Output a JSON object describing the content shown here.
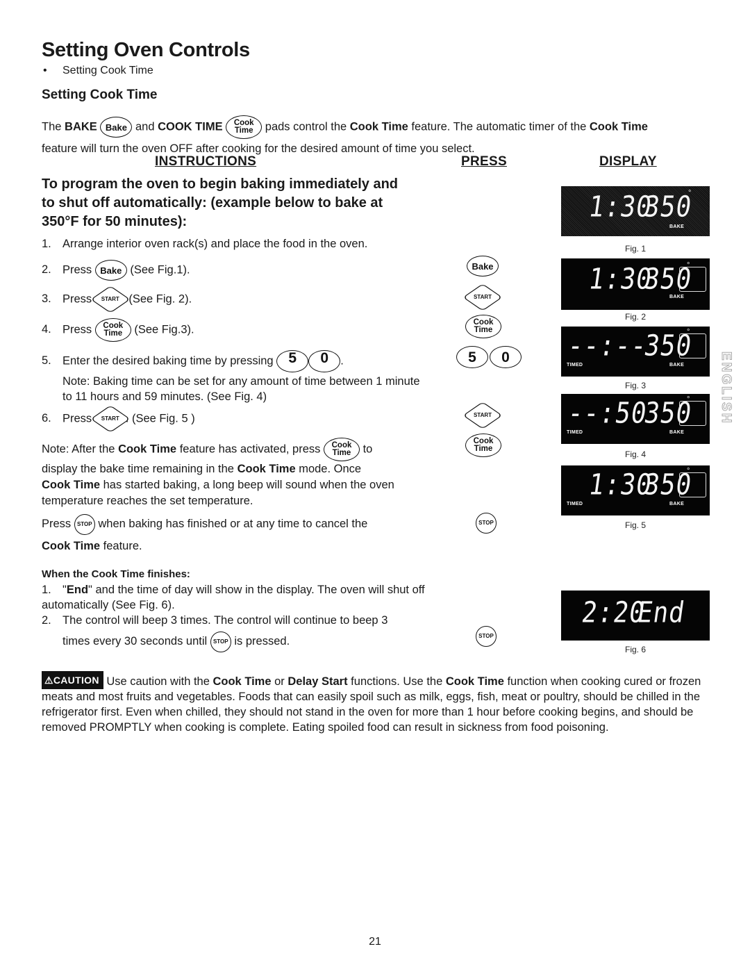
{
  "page": {
    "title": "Setting Oven Controls",
    "bullet": "Setting Cook Time",
    "section_heading": "Setting Cook Time",
    "page_number": "21",
    "side_tab": "ENGLISH"
  },
  "intro": {
    "p1": "The ",
    "bake_bold": "BAKE",
    "and": " and ",
    "cook_time_bold": "COOK TIME",
    "p2": " pads control the ",
    "ct1": "Cook Time",
    "p3": " feature. The automatic timer of the ",
    "ct2": "Cook Time",
    "p4": "feature will turn the oven OFF after cooking for the desired amount of time you select."
  },
  "columns": {
    "instructions": "INSTRUCTIONS",
    "press": "PRESS",
    "display": "DISPLAY"
  },
  "program_title": "To program the oven to begin baking immediately and to shut off automatically: (example below to bake at 350°F for 50 minutes):",
  "pads": {
    "bake": "Bake",
    "start": "START",
    "cook_line1": "Cook",
    "cook_line2": "Time",
    "stop": "STOP",
    "five": "5",
    "zero": "0"
  },
  "steps": [
    {
      "num": "1.",
      "text": "Arrange interior oven rack(s) and place the food in the oven."
    },
    {
      "num": "2.",
      "pre": "Press",
      "post": "(See Fig.1)."
    },
    {
      "num": "3.",
      "pre": "Press",
      "post": "(See Fig. 2)."
    },
    {
      "num": "4.",
      "pre": "Press",
      "post": "(See Fig.3)."
    },
    {
      "num": "5.",
      "pre": "Enter the desired baking time by pressing",
      "post": ".",
      "note": "Note: Baking time can be set for any amount of time between 1 minute to 11 hours and 59 minutes. (See Fig. 4)"
    },
    {
      "num": "6.",
      "pre": "Press",
      "post": ". (See Fig. 5 )"
    }
  ],
  "note_after": {
    "a": "Note: After the ",
    "ct": "Cook Time",
    "b": " feature has activated, press",
    "c": "to",
    "d": "display the bake time remaining in the ",
    "ct2": "Cook Time",
    "e": " mode. Once",
    "ct3": "Cook Time",
    "f": " has started baking, a long beep will sound when the oven temperature reaches the set temperature."
  },
  "stop_para": {
    "a": "Press",
    "b": "when baking has finished or at any time to cancel the",
    "ct": "Cook Time",
    "c": " feature."
  },
  "finish": {
    "heading": "When the Cook Time finishes:",
    "items": [
      {
        "num": "1.",
        "q": "\"",
        "bold": "End",
        "text": "\" and the time of day will show in the display. The oven will shut off automatically (See Fig. 6)."
      },
      {
        "num": "2.",
        "text": "The control will beep 3 times. The control will continue to beep 3",
        "text2a": "times every 30 seconds until",
        "text2b": "is pressed."
      }
    ]
  },
  "displays": [
    {
      "fig": "Fig. 1",
      "time": "1:30",
      "temp": "350",
      "deg": "°",
      "mode": "BAKE",
      "timed": "",
      "box": false
    },
    {
      "fig": "Fig. 2",
      "time": "1:30",
      "temp": "350",
      "deg": "°",
      "mode": "BAKE",
      "timed": "",
      "box": true
    },
    {
      "fig": "Fig. 3",
      "time": "--:--",
      "temp": "350",
      "deg": "°",
      "mode": "BAKE",
      "timed": "TIMED",
      "box": true
    },
    {
      "fig": "Fig. 4",
      "time": "--:50",
      "temp": "350",
      "deg": "°",
      "mode": "BAKE",
      "timed": "TIMED",
      "box": true
    },
    {
      "fig": "Fig. 5",
      "time": "1:30",
      "temp": "350",
      "deg": "°",
      "mode": "BAKE",
      "timed": "TIMED",
      "box": true
    },
    {
      "fig": "Fig. 6",
      "time": "2:20",
      "temp": "End",
      "deg": "",
      "mode": "",
      "timed": "",
      "box": false
    }
  ],
  "caution": {
    "badge": "CAUTION",
    "a": " Use caution with the ",
    "ct": "Cook Time",
    "b": " or ",
    "ds": "Delay Start",
    "c": " functions. Use the ",
    "ct2": "Cook Time",
    "d": " function when cooking cured or frozen meats and most fruits and vegetables. Foods that can easily spoil such as milk, eggs, fish, meat or poultry, should be chilled in the refrigerator first. Even when chilled, they should not stand in the oven for more than 1 hour before cooking begins, and should be removed PROMPTLY when cooking is complete. Eating spoiled food can result in sickness from food poisoning."
  }
}
